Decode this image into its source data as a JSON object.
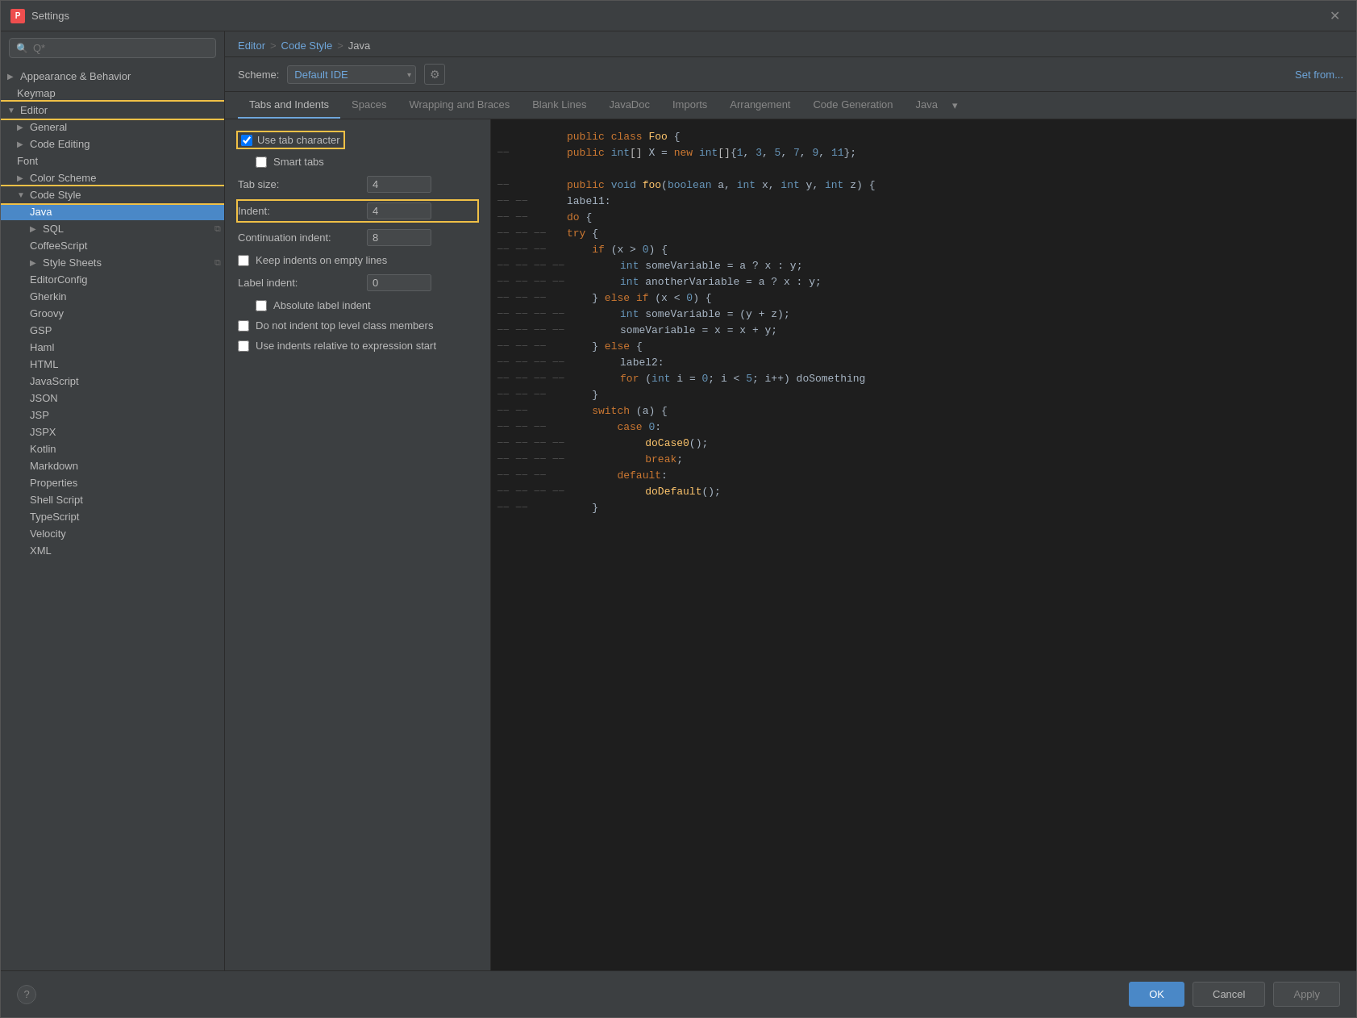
{
  "window": {
    "title": "Settings",
    "icon": "P"
  },
  "breadcrumb": {
    "parts": [
      "Editor",
      "Code Style",
      "Java"
    ],
    "separators": [
      ">",
      ">"
    ]
  },
  "scheme": {
    "label": "Scheme:",
    "value": "Default  IDE",
    "set_from": "Set from..."
  },
  "tabs": [
    {
      "label": "Tabs and Indents",
      "active": true
    },
    {
      "label": "Spaces"
    },
    {
      "label": "Wrapping and Braces"
    },
    {
      "label": "Blank Lines"
    },
    {
      "label": "JavaDoc"
    },
    {
      "label": "Imports"
    },
    {
      "label": "Arrangement"
    },
    {
      "label": "Code Generation"
    },
    {
      "label": "Java"
    }
  ],
  "settings": {
    "use_tab_character": {
      "label": "Use tab character",
      "checked": true
    },
    "smart_tabs": {
      "label": "Smart tabs",
      "checked": false
    },
    "tab_size": {
      "label": "Tab size:",
      "value": "4"
    },
    "indent": {
      "label": "Indent:",
      "value": "4"
    },
    "continuation_indent": {
      "label": "Continuation indent:",
      "value": "8"
    },
    "keep_indents": {
      "label": "Keep indents on empty lines",
      "checked": false
    },
    "label_indent": {
      "label": "Label indent:",
      "value": "0"
    },
    "absolute_label_indent": {
      "label": "Absolute label indent",
      "checked": false
    },
    "no_indent_top_level": {
      "label": "Do not indent top level class members",
      "checked": false
    },
    "use_indents_relative": {
      "label": "Use indents relative to expression start",
      "checked": false
    }
  },
  "sidebar": {
    "search_placeholder": "Q*",
    "items": [
      {
        "id": "appearance",
        "label": "Appearance & Behavior",
        "level": 0,
        "expandable": true,
        "expanded": false
      },
      {
        "id": "keymap",
        "label": "Keymap",
        "level": 0,
        "expandable": false
      },
      {
        "id": "editor",
        "label": "Editor",
        "level": 0,
        "expandable": true,
        "expanded": true,
        "highlighted": true
      },
      {
        "id": "general",
        "label": "General",
        "level": 1,
        "expandable": true
      },
      {
        "id": "code-editing",
        "label": "Code Editing",
        "level": 1,
        "expandable": true
      },
      {
        "id": "font",
        "label": "Font",
        "level": 1,
        "expandable": false
      },
      {
        "id": "color-scheme",
        "label": "Color Scheme",
        "level": 1,
        "expandable": true
      },
      {
        "id": "code-style",
        "label": "Code Style",
        "level": 1,
        "expandable": true,
        "expanded": true,
        "highlighted": true
      },
      {
        "id": "java",
        "label": "Java",
        "level": 2,
        "expandable": false,
        "selected": true
      },
      {
        "id": "sql",
        "label": "SQL",
        "level": 2,
        "expandable": true,
        "copy_icon": true
      },
      {
        "id": "coffeescript",
        "label": "CoffeeScript",
        "level": 2
      },
      {
        "id": "style-sheets",
        "label": "Style Sheets",
        "level": 2,
        "expandable": true,
        "copy_icon": true
      },
      {
        "id": "editorconfig",
        "label": "EditorConfig",
        "level": 2
      },
      {
        "id": "gherkin",
        "label": "Gherkin",
        "level": 2
      },
      {
        "id": "groovy",
        "label": "Groovy",
        "level": 2
      },
      {
        "id": "gsp",
        "label": "GSP",
        "level": 2
      },
      {
        "id": "haml",
        "label": "Haml",
        "level": 2
      },
      {
        "id": "html",
        "label": "HTML",
        "level": 2
      },
      {
        "id": "javascript",
        "label": "JavaScript",
        "level": 2
      },
      {
        "id": "json",
        "label": "JSON",
        "level": 2
      },
      {
        "id": "jsp",
        "label": "JSP",
        "level": 2
      },
      {
        "id": "jspx",
        "label": "JSPX",
        "level": 2
      },
      {
        "id": "kotlin",
        "label": "Kotlin",
        "level": 2
      },
      {
        "id": "markdown",
        "label": "Markdown",
        "level": 2
      },
      {
        "id": "properties",
        "label": "Properties",
        "level": 2
      },
      {
        "id": "shell-script",
        "label": "Shell Script",
        "level": 2
      },
      {
        "id": "typescript",
        "label": "TypeScript",
        "level": 2
      },
      {
        "id": "velocity",
        "label": "Velocity",
        "level": 2
      },
      {
        "id": "xml",
        "label": "XML",
        "level": 2
      }
    ]
  },
  "buttons": {
    "ok": "OK",
    "cancel": "Cancel",
    "apply": "Apply"
  },
  "code_preview": {
    "lines": [
      "public class Foo {",
      "    public int[] X = new int[]{1, 3, 5, 7, 9, 11};",
      "",
      "    public void foo(boolean a, int x, int y, int z) {",
      "        label1:",
      "        do {",
      "            try {",
      "                if (x > 0) {",
      "                    int someVariable = a ? x : y;",
      "                    int anotherVariable = a ? x : y;",
      "                } else if (x < 0) {",
      "                    int someVariable = (y + z);",
      "                    someVariable = x = x + y;",
      "                } else {",
      "                    label2:",
      "                    for (int i = 0; i < 5; i++) doSomething",
      "                }",
      "                switch (a) {",
      "                    case 0:",
      "                        doCase0();",
      "                        break;",
      "                    default:",
      "                        doDefault();",
      "                }",
      "            }"
    ]
  }
}
